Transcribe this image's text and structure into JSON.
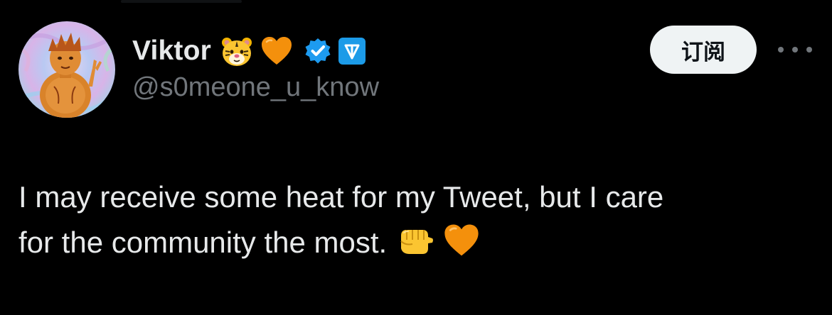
{
  "author": {
    "display_name": "Viktor",
    "handle": "@s0meone_u_know",
    "name_emojis": [
      "tiger-face-icon",
      "orange-heart-icon"
    ],
    "badges": [
      "verified-badge-icon",
      "ton-badge-icon"
    ]
  },
  "actions": {
    "subscribe_label": "订阅",
    "more_icon": "more-options-icon"
  },
  "tweet": {
    "line1": "I may receive some heat for my Tweet, but I care",
    "line2": "for the community the most.",
    "trailing_emojis": [
      "oncoming-fist-icon",
      "orange-heart-icon"
    ]
  },
  "colors": {
    "background": "#000000",
    "primary_text": "#e7e9ea",
    "secondary_text": "#71767b",
    "verified_blue": "#1d9bf0",
    "button_bg": "#eff3f4",
    "heart_orange": "#f4900c"
  }
}
